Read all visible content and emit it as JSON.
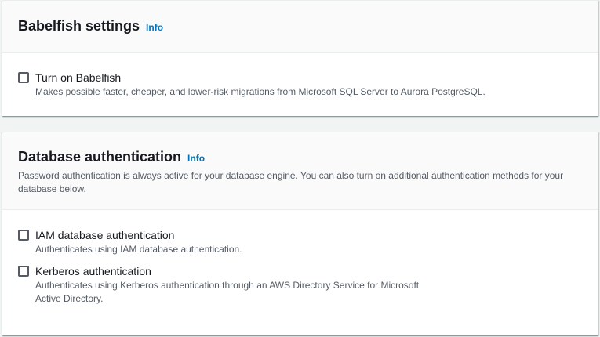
{
  "babelfish": {
    "title": "Babelfish settings",
    "info": "Info",
    "option": {
      "label": "Turn on Babelfish",
      "description": "Makes possible faster, cheaper, and lower-risk migrations from Microsoft SQL Server to Aurora PostgreSQL.",
      "checked": false
    }
  },
  "db_auth": {
    "title": "Database authentication",
    "info": "Info",
    "description": "Password authentication is always active for your database engine. You can also turn on additional authentication methods for your database below.",
    "options": [
      {
        "label": "IAM database authentication",
        "description": "Authenticates using IAM database authentication.",
        "checked": false
      },
      {
        "label": "Kerberos authentication",
        "description": "Authenticates using Kerberos authentication through an AWS Directory Service for Microsoft Active Directory.",
        "checked": false
      }
    ]
  },
  "colors": {
    "link": "#0073bb",
    "text": "#16191f",
    "secondary_text": "#545b64",
    "background": "#f2f3f3"
  }
}
